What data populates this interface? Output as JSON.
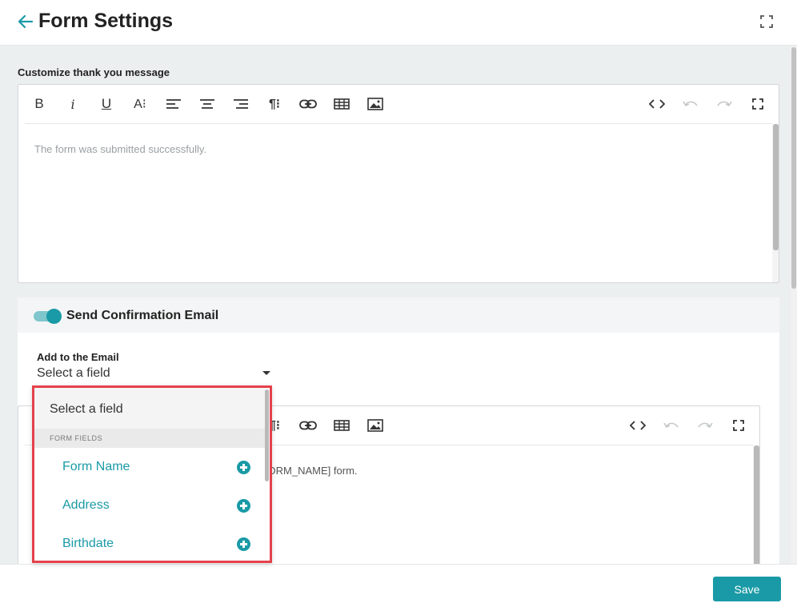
{
  "header": {
    "title": "Form Settings"
  },
  "thank_you": {
    "label": "Customize thank you message",
    "placeholder": "The form was submitted successfully."
  },
  "toolbar": {
    "bold": "B",
    "italic": "i",
    "underline": "U",
    "font_size": "A⁝",
    "paragraph": "¶⁝"
  },
  "confirmation": {
    "title": "Send Confirmation Email",
    "enabled": true,
    "add_label": "Add to the Email",
    "select_value": "Select a field",
    "body_text": "[FORM_NAME] form."
  },
  "dropdown": {
    "current": "Select a field",
    "group_label": "FORM FIELDS",
    "items": [
      {
        "label": "Form Name"
      },
      {
        "label": "Address"
      },
      {
        "label": "Birthdate"
      }
    ]
  },
  "footer": {
    "save_label": "Save"
  },
  "colors": {
    "accent": "#1a9aa6",
    "highlight": "#e5414b"
  }
}
